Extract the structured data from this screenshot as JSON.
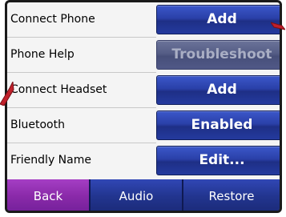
{
  "settings_rows": [
    {
      "label": "Connect Phone",
      "button": "Add"
    },
    {
      "label": "Phone Help",
      "button": "Troubleshoot"
    },
    {
      "label": "Connect Headset",
      "button": "Add"
    },
    {
      "label": "Bluetooth",
      "button": "Enabled"
    },
    {
      "label": "Friendly Name",
      "button": "Edit..."
    }
  ],
  "bottom_bar": {
    "back": "Back",
    "audio": "Audio",
    "restore": "Restore"
  },
  "colors": {
    "button_blue": "#2a40a8",
    "back_purple": "#8a2aa9",
    "pointer_red": "#c0202a"
  },
  "icons": {
    "top_right_pointer": "red-arrow-pointer-icon",
    "left_pointer": "red-arrow-pointer-icon"
  }
}
